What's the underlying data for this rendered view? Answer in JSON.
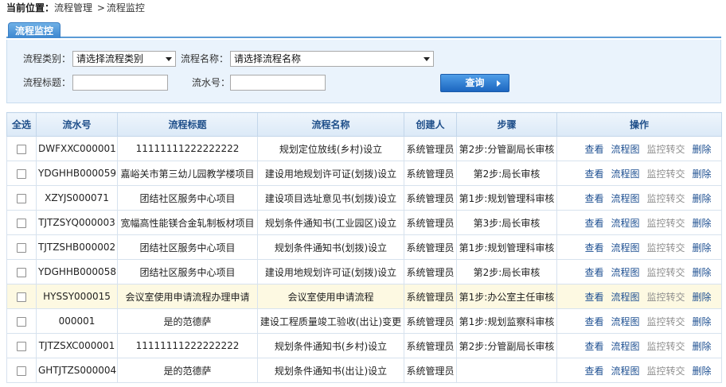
{
  "breadcrumb": {
    "label": "当前位置：",
    "items": [
      "流程管理",
      "流程监控"
    ],
    "separator": ">"
  },
  "tab": {
    "label": "流程监控"
  },
  "filters": {
    "category_label": "流程类别：",
    "category_value": "请选择流程类别",
    "name_label": "流程名称：",
    "name_value": "请选择流程名称",
    "title_label": "流程标题：",
    "title_value": "",
    "serial_label": "流水号：",
    "serial_value": "",
    "query_button": "查询"
  },
  "table": {
    "headers": [
      "全选",
      "流水号",
      "流程标题",
      "流程名称",
      "创建人",
      "步骤",
      "操作"
    ],
    "operations": {
      "view": "查看",
      "flowchart": "流程图",
      "transfer": "监控转交",
      "delete": "删除"
    },
    "rows": [
      {
        "serial": "DWFXXC000001",
        "title": "11111111222222222",
        "name": "规划定位放线(乡村)设立",
        "creator": "系统管理员",
        "step": "第2步:分管副局长审核"
      },
      {
        "serial": "YDGHHB000059",
        "title": "嘉峪关市第三幼儿园教学楼项目",
        "name": "建设用地规划许可证(划拨)设立",
        "creator": "系统管理员",
        "step": "第2步:局长审核"
      },
      {
        "serial": "XZYJS000071",
        "title": "团结社区服务中心项目",
        "name": "建设项目选址意见书(划拨)设立",
        "creator": "系统管理员",
        "step": "第1步:规划管理科审核"
      },
      {
        "serial": "TJTZSYQ000003",
        "title": "宽幅高性能镁合金轧制板材项目",
        "name": "规划条件通知书(工业园区)设立",
        "creator": "系统管理员",
        "step": "第3步:局长审核"
      },
      {
        "serial": "TJTZSHB000002",
        "title": "团结社区服务中心项目",
        "name": "规划条件通知书(划拨)设立",
        "creator": "系统管理员",
        "step": "第1步:规划管理科审核"
      },
      {
        "serial": "YDGHHB000058",
        "title": "团结社区服务中心项目",
        "name": "建设用地规划许可证(划拨)设立",
        "creator": "系统管理员",
        "step": "第2步:局长审核"
      },
      {
        "serial": "HYSSY000015",
        "title": "会议室使用申请流程办理申请",
        "name": "会议室使用申请流程",
        "creator": "系统管理员",
        "step": "第1步:办公室主任审核"
      },
      {
        "serial": "000001",
        "title": "是的范德萨",
        "name": "建设工程质量竣工验收(出让)变更",
        "creator": "系统管理员",
        "step": "第1步:规划监察科审核"
      },
      {
        "serial": "TJTZSXC000001",
        "title": "11111111222222222",
        "name": "规划条件通知书(乡村)设立",
        "creator": "系统管理员",
        "step": "第2步:分管副局长审核"
      },
      {
        "serial": "GHTJTZS000004",
        "title": "是的范德萨",
        "name": "规划条件通知书(出让)设立",
        "creator": "系统管理员",
        "step": ""
      }
    ]
  }
}
